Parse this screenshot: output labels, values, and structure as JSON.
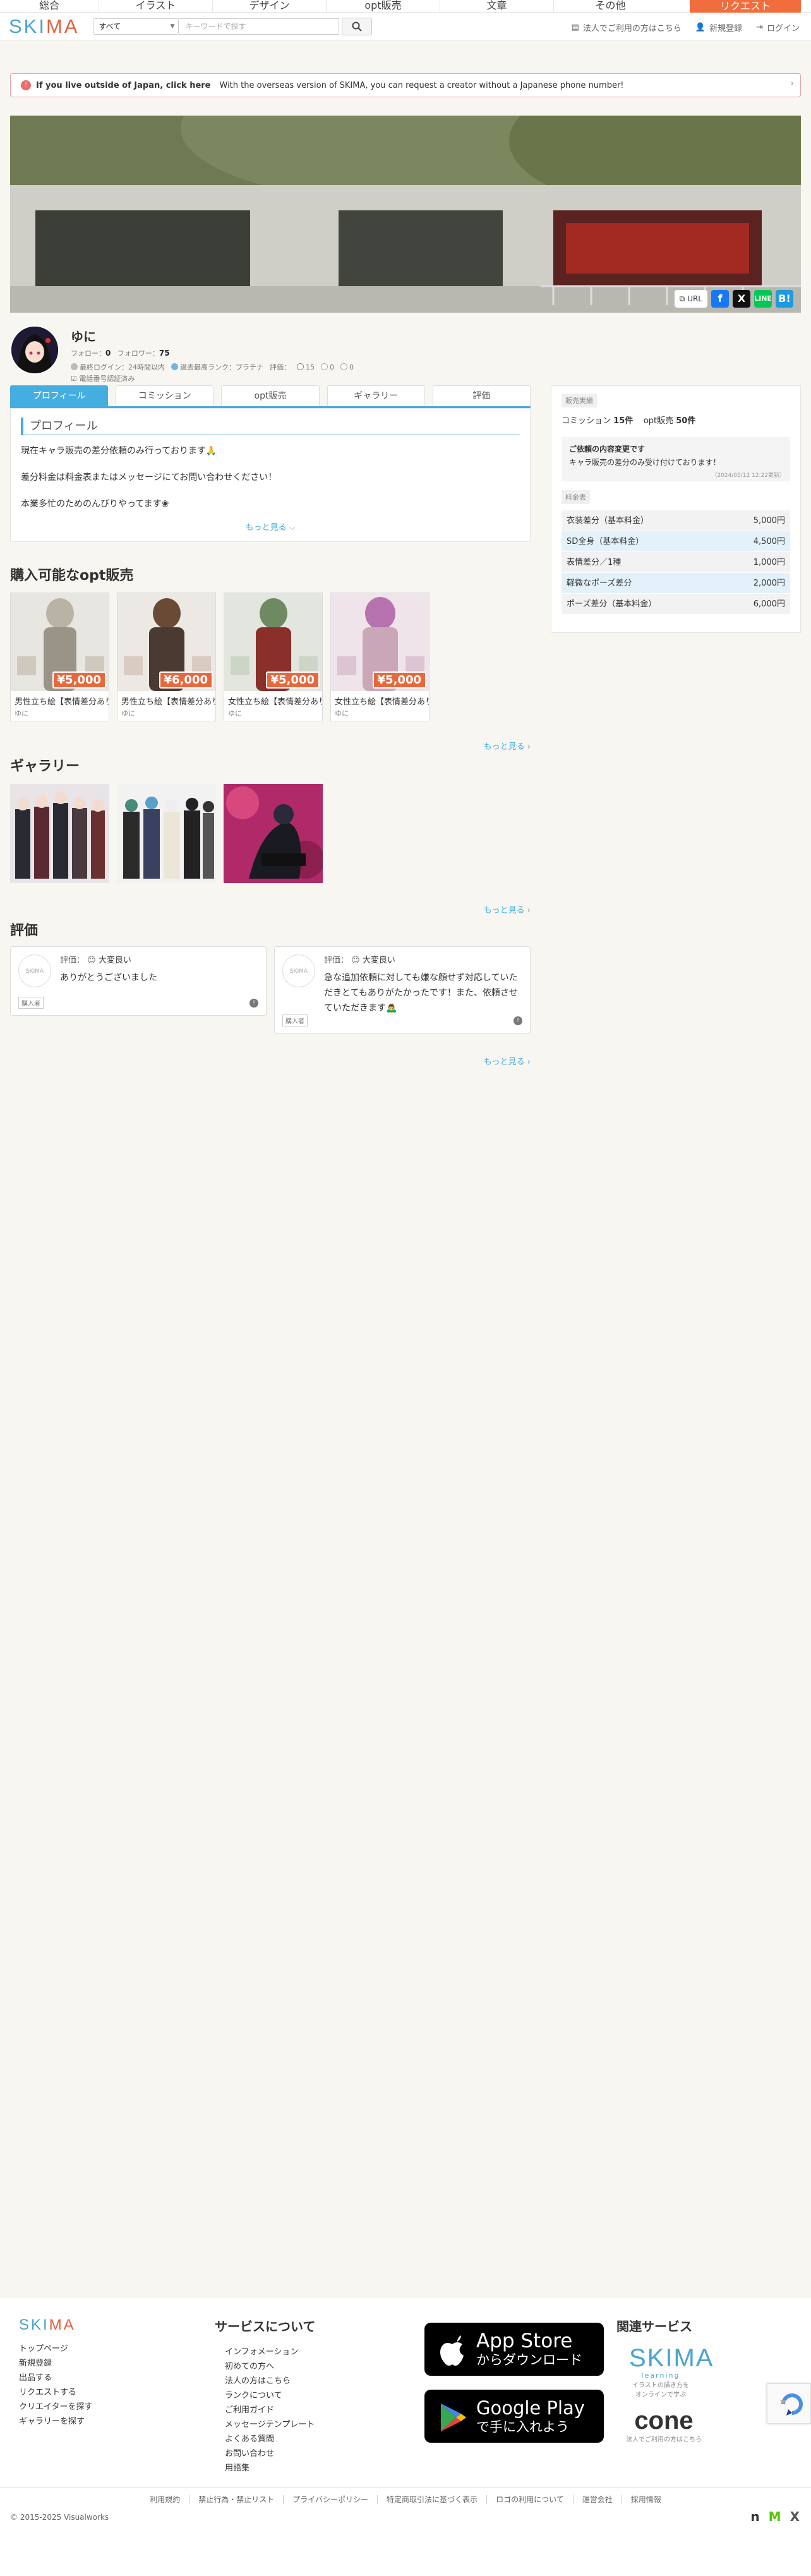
{
  "nav": {
    "categories": [
      "総合",
      "イラスト",
      "デザイン",
      "opt販売",
      "文章",
      "その他"
    ],
    "request": "リクエスト"
  },
  "header": {
    "logo_a": "SKI",
    "logo_b": "MA",
    "select_value": "すべて",
    "search_placeholder": "キーワードで探す",
    "corporate": "法人でご利用の方はこちら",
    "register": "新規登録",
    "login": "ログイン"
  },
  "banner": {
    "bold": "If you live outside of Japan, click here",
    "text": "With the overseas version of SKIMA, you can request a creator without a Japanese phone number!"
  },
  "share": {
    "url_label": "URL"
  },
  "profile": {
    "name": "ゆに",
    "follow_label": "フォロー：",
    "follow": "0",
    "follower_label": "フォロワー：",
    "follower": "75",
    "last_login": "最終ログイン：24時間以内",
    "rank": "過去最高ランク：プラチナ",
    "rating_label": "評価：",
    "rating_good": "15",
    "rating_mid": "0",
    "rating_bad": "0",
    "verified": "電話番号認証済み"
  },
  "tabs": [
    "プロフィール",
    "コミッション",
    "opt販売",
    "ギャラリー",
    "評価"
  ],
  "profile_box": {
    "title": "プロフィール",
    "line1": "現在キャラ販売の差分依頼のみ行っております🙏",
    "line2": "差分料金は料金表またはメッセージにてお問い合わせください！",
    "line3": "本業多忙のためのんびりやってます❀",
    "more": "もっと見る ⌵"
  },
  "sidebar": {
    "label_sales": "販売実績",
    "commission_label": "コミッション",
    "commission_count": "15件",
    "opt_label": "opt販売",
    "opt_count": "50件",
    "notice_title": "ご依頼の内容変更です",
    "notice_text": "キャラ販売の差分のみ受け付けております！",
    "notice_date": "（2024/05/12 12:22更新）",
    "label_price": "料金表",
    "prices": [
      {
        "name": "衣装差分（基本料金）",
        "price": "5,000円"
      },
      {
        "name": "SD全身（基本料金）",
        "price": "4,500円"
      },
      {
        "name": "表情差分／1種",
        "price": "1,000円"
      },
      {
        "name": "軽微なポーズ差分",
        "price": "2,000円"
      },
      {
        "name": "ポーズ差分（基本料金）",
        "price": "6,000円"
      }
    ]
  },
  "sections": {
    "opt": "購入可能なopt販売",
    "gallery": "ギャラリー",
    "reviews": "評価",
    "more": "もっと見る ›"
  },
  "products": [
    {
      "name": "男性立ち絵【表情差分あり】",
      "price": "¥5,000",
      "by": "ゆに"
    },
    {
      "name": "男性立ち絵【表情差分あり】",
      "price": "¥6,000",
      "by": "ゆに"
    },
    {
      "name": "女性立ち絵【表情差分あり】",
      "price": "¥5,000",
      "by": "ゆに"
    },
    {
      "name": "女性立ち絵【表情差分あり】",
      "price": "¥5,000",
      "by": "ゆに"
    }
  ],
  "reviews": [
    {
      "rating_label": "評価：",
      "rating": "大変良い",
      "text": "ありがとうございました",
      "buyer": "購入者"
    },
    {
      "rating_label": "評価：",
      "rating": "大変良い",
      "text": "急な追加依頼に対しても嫌な顔せず対応していただきとてもありがたかったです！また、依頼させていただきます🙇‍♂️",
      "buyer": "購入者"
    }
  ],
  "footer": {
    "col1": [
      "トップページ",
      "新規登録",
      "出品する",
      "リクエストする",
      "クリエイターを探す",
      "ギャラリーを探す"
    ],
    "col2_title": "サービスについて",
    "col2": [
      "インフォメーション",
      "初めての方へ",
      "法人の方はこちら",
      "ランクについて",
      "ご利用ガイド",
      "メッセージテンプレート",
      "よくある質問",
      "お問い合わせ",
      "用語集"
    ],
    "appstore_big": "App Store",
    "appstore_small": "からダウンロード",
    "googleplay_big": "Google Play",
    "googleplay_small": "で手に入れよう",
    "related_title": "関連サービス",
    "learning": "SKIMA",
    "learning_sub1": "learning",
    "learning_sub2": "イラストの描き方を",
    "learning_sub3": "オンラインで学ぶ",
    "cone": "cone",
    "cone_sub": "法人でご利用の方はこちら",
    "links": [
      "利用規約",
      "禁止行為・禁止リスト",
      "プライバシーポリシー",
      "特定商取引法に基づく表示",
      "ロゴの利用について",
      "運営会社",
      "採用情報"
    ],
    "copyright": "© 2015-2025 Visualworks"
  }
}
